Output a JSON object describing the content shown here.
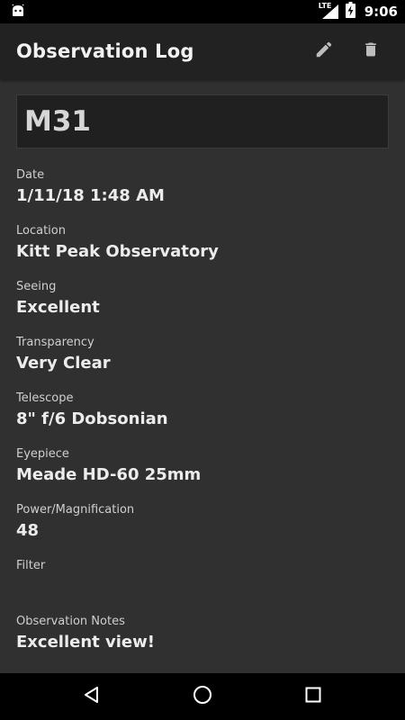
{
  "status_bar": {
    "network": "LTE",
    "time": "9:06"
  },
  "app_bar": {
    "title": "Observation Log",
    "edit_icon": "pencil-icon",
    "delete_icon": "trash-icon"
  },
  "observation": {
    "name": "M31",
    "fields": [
      {
        "label": "Date",
        "value": "1/11/18 1:48 AM"
      },
      {
        "label": "Location",
        "value": "Kitt Peak Observatory"
      },
      {
        "label": "Seeing",
        "value": "Excellent"
      },
      {
        "label": "Transparency",
        "value": "Very Clear"
      },
      {
        "label": "Telescope",
        "value": "8\" f/6 Dobsonian"
      },
      {
        "label": "Eyepiece",
        "value": "Meade HD-60 25mm"
      },
      {
        "label": "Power/Magnification",
        "value": "48"
      },
      {
        "label": "Filter",
        "value": ""
      },
      {
        "label": "Observation Notes",
        "value": "Excellent view!"
      }
    ]
  },
  "colors": {
    "background": "#303030",
    "app_bar": "#222222",
    "status_bar": "#000000"
  }
}
